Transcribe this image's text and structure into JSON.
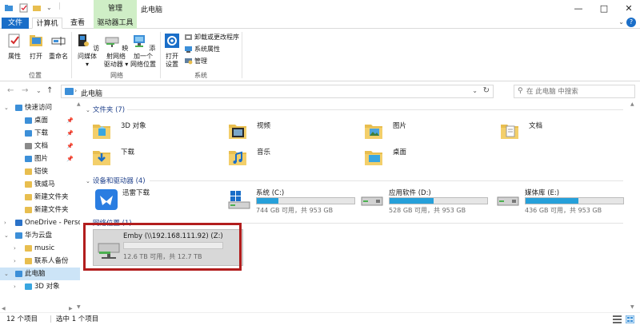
{
  "window": {
    "title": "此电脑",
    "context_tab": "管理",
    "controls": {
      "minimize": "—",
      "maximize": "□",
      "close": "✕"
    }
  },
  "tabs": {
    "file": "文件",
    "computer": "计算机",
    "view": "查看",
    "drive_tools": "驱动器工具",
    "ribbon_toggle": "⌄",
    "help": "?"
  },
  "ribbon": {
    "location_group": {
      "label": "位置",
      "buttons": {
        "properties": "属性",
        "open": "打开",
        "rename": "重命名"
      }
    },
    "network_group": {
      "label": "网络",
      "buttons": {
        "media": [
          "访问媒体",
          "▾"
        ],
        "map_drive": [
          "映射网络",
          "驱动器 ▾"
        ],
        "add_location": [
          "添加一个",
          "网络位置"
        ]
      }
    },
    "system_group": {
      "label": "系统",
      "open_settings": [
        "打开",
        "设置"
      ],
      "small": [
        "卸载或更改程序",
        "系统属性",
        "管理"
      ]
    }
  },
  "address_bar": {
    "back": "←",
    "forward": "→",
    "history": "⌄",
    "up": "↑",
    "crumb_sep": "›",
    "path": "此电脑",
    "dropdown": "⌄",
    "refresh": "↻",
    "search_placeholder": "在 此电脑 中搜索"
  },
  "nav_pane": {
    "items": [
      {
        "label": "快速访问",
        "expander": "⌄",
        "indent": 0,
        "icon": "star-icon",
        "color": "#3c8fd8"
      },
      {
        "label": "桌面",
        "indent": 1,
        "icon": "desktop-icon",
        "color": "#3c8fd8",
        "pinned": true
      },
      {
        "label": "下载",
        "indent": 1,
        "icon": "download-icon",
        "color": "#3c8fd8",
        "pinned": true
      },
      {
        "label": "文档",
        "indent": 1,
        "icon": "document-icon",
        "color": "#8a8a8a",
        "pinned": true
      },
      {
        "label": "图片",
        "indent": 1,
        "icon": "picture-icon",
        "color": "#3c8fd8",
        "pinned": true
      },
      {
        "label": "铠侠",
        "indent": 1,
        "icon": "folder-icon",
        "color": "#e8be4f"
      },
      {
        "label": "铁威马",
        "indent": 1,
        "icon": "folder-icon",
        "color": "#e8be4f"
      },
      {
        "label": "新建文件夹",
        "indent": 1,
        "icon": "folder-icon",
        "color": "#e8be4f"
      },
      {
        "label": "新建文件夹",
        "indent": 1,
        "icon": "folder-icon",
        "color": "#e8be4f"
      },
      {
        "label": "OneDrive - Perso",
        "expander": "›",
        "indent": 0,
        "icon": "cloud-icon",
        "color": "#2a72c8"
      },
      {
        "label": "华为云盘",
        "expander": "⌄",
        "indent": 0,
        "icon": "cloud-icon",
        "color": "#3c8fd8"
      },
      {
        "label": "music",
        "expander": "›",
        "indent": 1,
        "icon": "folder-icon",
        "color": "#e8be4f"
      },
      {
        "label": "联系人备份",
        "expander": "›",
        "indent": 1,
        "icon": "folder-icon",
        "color": "#e8be4f"
      },
      {
        "label": "此电脑",
        "expander": "⌄",
        "indent": 0,
        "icon": "computer-icon",
        "color": "#3c8fd8",
        "selected": true
      },
      {
        "label": "3D 对象",
        "expander": "›",
        "indent": 1,
        "icon": "cube-icon",
        "color": "#39a6e0"
      }
    ],
    "pin_glyph": "📌"
  },
  "main": {
    "folders_header": "文件夹 (7)",
    "folders": [
      {
        "name": "3D 对象",
        "icon": "3d-objects-folder-icon"
      },
      {
        "name": "视频",
        "icon": "videos-folder-icon"
      },
      {
        "name": "图片",
        "icon": "pictures-folder-icon"
      },
      {
        "name": "文档",
        "icon": "documents-folder-icon"
      },
      {
        "name": "下载",
        "icon": "downloads-folder-icon"
      },
      {
        "name": "音乐",
        "icon": "music-folder-icon"
      },
      {
        "name": "桌面",
        "icon": "desktop-folder-icon"
      }
    ],
    "devices_header": "设备和驱动器 (4)",
    "devices": [
      {
        "name": "迅雷下载",
        "icon": "xunlei-icon",
        "bar": false
      },
      {
        "name": "系统 (C:)",
        "free": "744 GB 可用，共 953 GB",
        "used_fraction": 0.22,
        "icon": "windows-drive-icon",
        "bar": true
      },
      {
        "name": "应用软件 (D:)",
        "free": "528 GB 可用，共 953 GB",
        "used_fraction": 0.45,
        "icon": "drive-icon",
        "bar": true
      },
      {
        "name": "媒体库 (E:)",
        "free": "436 GB 可用，共 953 GB",
        "used_fraction": 0.54,
        "icon": "drive-icon",
        "bar": true
      }
    ],
    "network_header": "网络位置 (1)",
    "network_drive": {
      "name": "Emby (\\\\192.168.111.92) (Z:)",
      "free": "12.6 TB 可用，共 12.7 TB",
      "used_fraction": 0.01,
      "icon": "network-drive-icon"
    }
  },
  "status": {
    "count": "12 个项目",
    "selected": "选中 1 个项目"
  },
  "colors": {
    "accent": "#1a6ec8",
    "manage_tab": "#cfeec6",
    "bar_fill": "#26a0da",
    "highlight_box": "#b21d1d",
    "folder": "#e8be4f"
  }
}
